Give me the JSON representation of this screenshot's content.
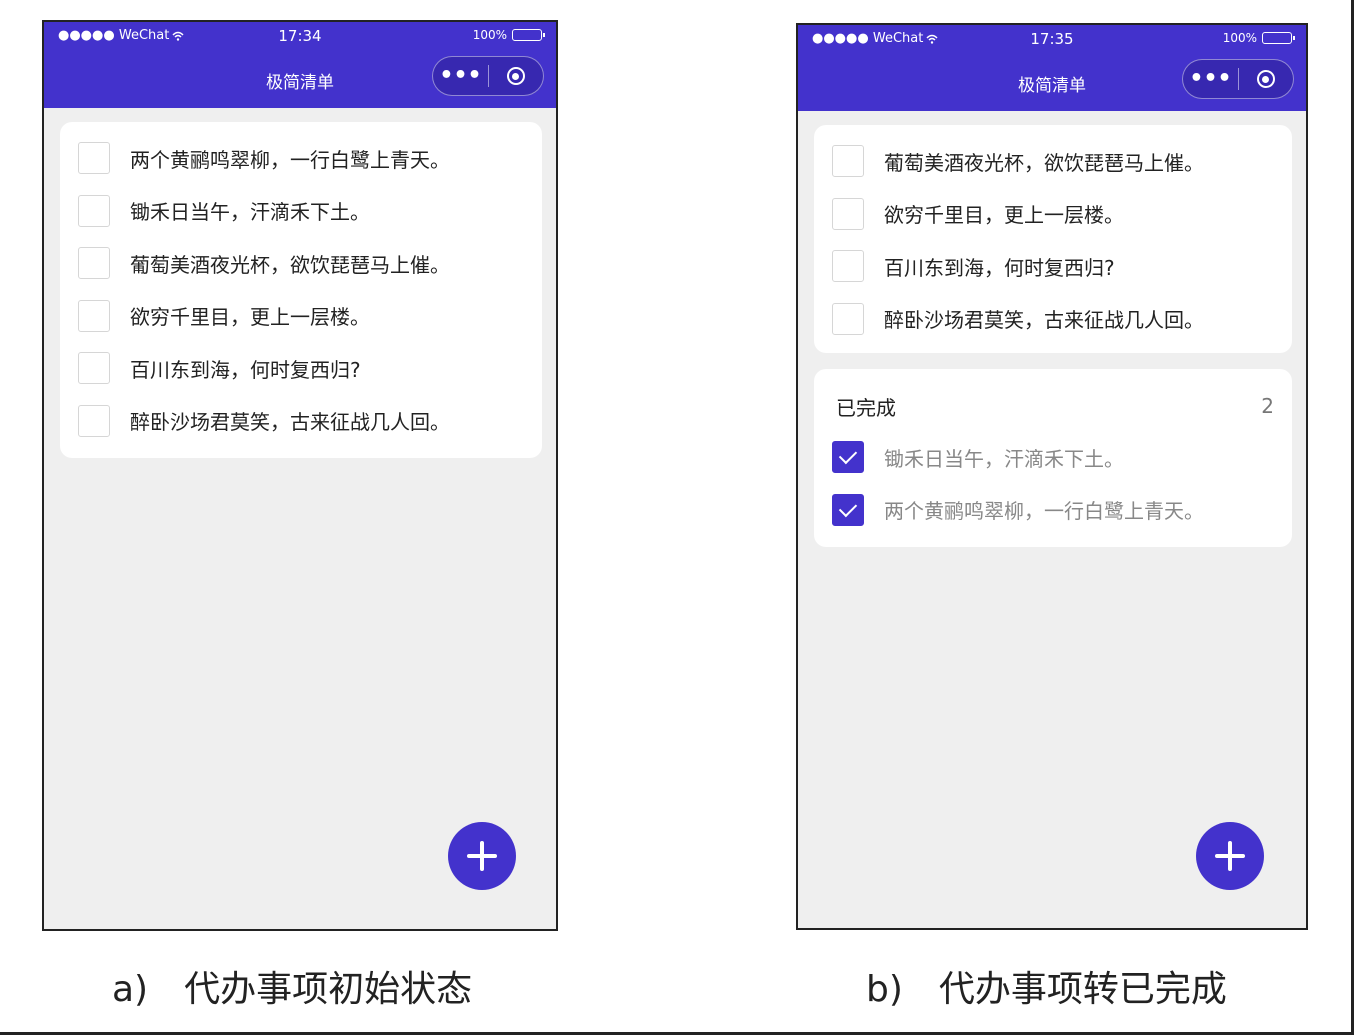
{
  "colors": {
    "accent": "#4332cc",
    "background": "#efefef",
    "card": "#ffffff"
  },
  "phone_a": {
    "carrier": "●●●●● WeChat",
    "time": "17:34",
    "battery": "100%",
    "title": "极简清单",
    "capsule_more": "•••",
    "todos": [
      {
        "text": "两个黄鹂鸣翠柳，一行白鹭上青天。",
        "checked": false
      },
      {
        "text": "锄禾日当午，汗滴禾下土。",
        "checked": false
      },
      {
        "text": "葡萄美酒夜光杯，欲饮琵琶马上催。",
        "checked": false
      },
      {
        "text": "欲穷千里目，更上一层楼。",
        "checked": false
      },
      {
        "text": "百川东到海，何时复西归?",
        "checked": false
      },
      {
        "text": "醉卧沙场君莫笑，古来征战几人回。",
        "checked": false
      }
    ]
  },
  "phone_b": {
    "carrier": "●●●●● WeChat",
    "time": "17:35",
    "battery": "100%",
    "title": "极简清单",
    "capsule_more": "•••",
    "todos": [
      {
        "text": "葡萄美酒夜光杯，欲饮琵琶马上催。",
        "checked": false
      },
      {
        "text": "欲穷千里目，更上一层楼。",
        "checked": false
      },
      {
        "text": "百川东到海，何时复西归?",
        "checked": false
      },
      {
        "text": "醉卧沙场君莫笑，古来征战几人回。",
        "checked": false
      }
    ],
    "completed_label": "已完成",
    "completed_count": "2",
    "completed": [
      {
        "text": "锄禾日当午，汗滴禾下土。",
        "checked": true
      },
      {
        "text": "两个黄鹂鸣翠柳，一行白鹭上青天。",
        "checked": true
      }
    ]
  },
  "captions": {
    "a_label": "a)",
    "a_text": "代办事项初始状态",
    "b_label": "b)",
    "b_text": "代办事项转已完成"
  }
}
